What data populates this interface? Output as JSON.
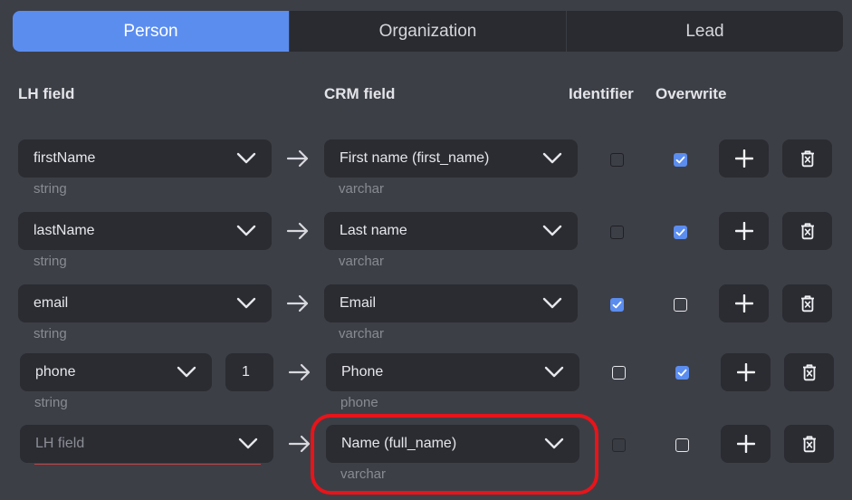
{
  "tabs": [
    {
      "label": "Person",
      "active": true
    },
    {
      "label": "Organization",
      "active": false
    },
    {
      "label": "Lead",
      "active": false
    }
  ],
  "columns": {
    "lh_field": "LH field",
    "crm_field": "CRM field",
    "identifier": "Identifier",
    "overwrite": "Overwrite"
  },
  "rows": [
    {
      "lh_field": "firstName",
      "lh_type": "string",
      "crm_field": "First name (first_name)",
      "crm_type": "varchar",
      "identifier": false,
      "overwrite": true
    },
    {
      "lh_field": "lastName",
      "lh_type": "string",
      "crm_field": "Last name",
      "crm_type": "varchar",
      "identifier": false,
      "overwrite": true
    },
    {
      "lh_field": "email",
      "lh_type": "string",
      "crm_field": "Email",
      "crm_type": "varchar",
      "identifier": true,
      "overwrite": false
    },
    {
      "lh_field": "phone",
      "lh_index": "1",
      "lh_type": "string",
      "crm_field": "Phone",
      "crm_type": "phone",
      "identifier": false,
      "overwrite": true
    },
    {
      "lh_field_placeholder": "LH field",
      "crm_field": "Name (full_name)",
      "crm_type": "varchar",
      "identifier": false,
      "overwrite": false
    }
  ],
  "icons": {
    "dropdown": "chevron-down-icon",
    "map_arrow": "arrow-right-icon",
    "add": "plus-icon",
    "delete": "trash-icon",
    "checked": "check-icon"
  },
  "colors": {
    "background": "#3d3f47",
    "field_bg": "#2b2c32",
    "accent": "#5b8def",
    "highlight": "#e8141a"
  }
}
